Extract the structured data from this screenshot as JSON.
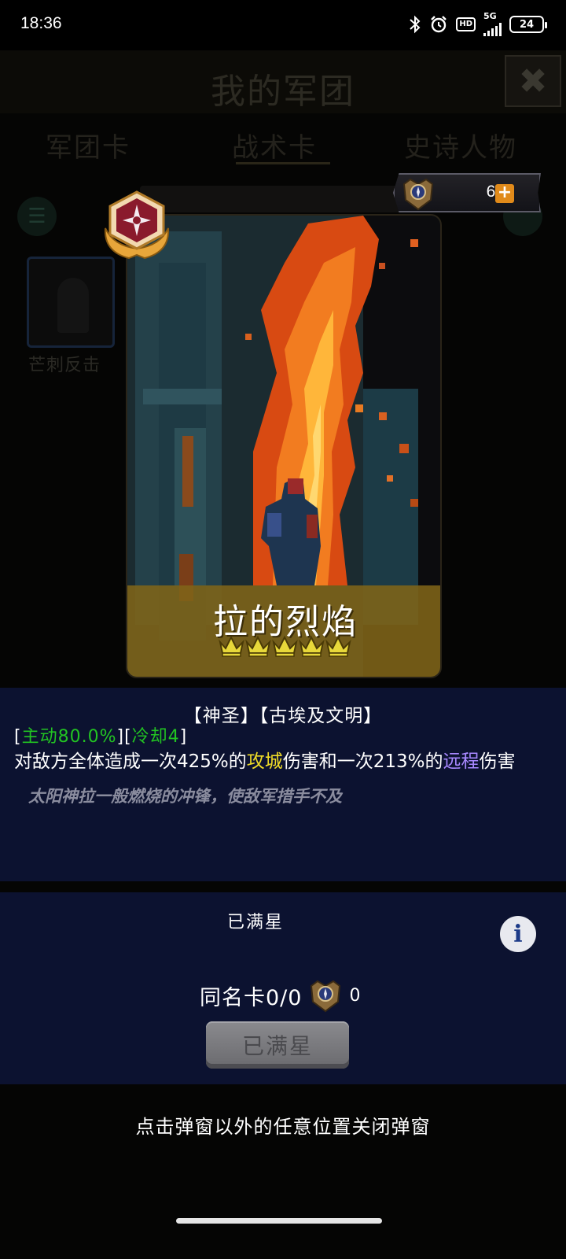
{
  "status_bar": {
    "time": "18:36",
    "network": "5G",
    "hd": "HD",
    "battery": "24"
  },
  "background": {
    "title": "我的军团",
    "close_icon": "close-icon",
    "tabs": [
      "军团卡",
      "战术卡",
      "史诗人物"
    ],
    "card_label": "芒刺反击"
  },
  "currency": {
    "count": "62",
    "add_symbol": "+"
  },
  "card": {
    "name": "拉的烈焰",
    "stars": 5,
    "accent_color": "#e05a10"
  },
  "description": {
    "tags": "【神圣】【古埃及文明】",
    "bracket_open": "[",
    "active_label": "主动80.0%",
    "bracket_mid": "][",
    "cooldown_label": "冷却4",
    "bracket_close": "]",
    "effect_part1": "对敌方全体造成一次425%的",
    "effect_type1": "攻城",
    "effect_part2": "伤害和一次213%的",
    "effect_type2": "远程",
    "effect_part3": "伤害",
    "flavor": "太阳神拉一般燃烧的冲锋，使敌军措手不及"
  },
  "star_panel": {
    "title": "已满星",
    "duplicate_label": "同名卡0/0",
    "duplicate_count": "0",
    "button_label": "已满星"
  },
  "close_hint": "点击弹窗以外的任意位置关闭弹窗"
}
